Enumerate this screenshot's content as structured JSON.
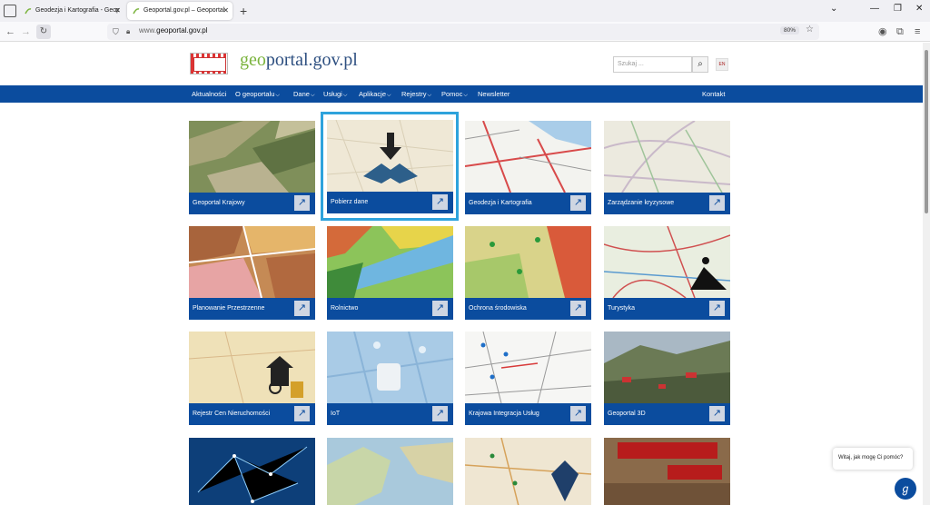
{
  "browser": {
    "tabs": [
      {
        "title": "Geodezja i Kartografia - Geopor"
      },
      {
        "title": "Geoportal.gov.pl – Geoportal In"
      }
    ],
    "url_prefix": "www.",
    "url_domain": "geoportal.gov.pl",
    "zoom": "80%"
  },
  "header": {
    "brand_geo": "geo",
    "brand_rest": "portal.gov.pl",
    "search_placeholder": "Szukaj ...",
    "lang": "EN"
  },
  "menu": {
    "items": [
      "Aktualności",
      "O geoportalu",
      "Dane",
      "Usługi",
      "Aplikacje",
      "Rejestry",
      "Pomoc",
      "Newsletter"
    ],
    "contact": "Kontakt"
  },
  "tiles": [
    "Geoportal Krajowy",
    "Pobierz dane",
    "Geodezja i Kartografia",
    "Zarządzanie kryzysowe",
    "Planowanie Przestrzenne",
    "Rolnictwo",
    "Ochrona środowiska",
    "Turystyka",
    "Rejestr Cen Nieruchomości",
    "IoT",
    "Krajowa Integracja Usług",
    "Geoportal 3D"
  ],
  "chat": {
    "bubble": "Witaj, jak mogę Ci pomóc?"
  },
  "colors": {
    "accent": "#0b4c9e",
    "highlight": "#2ea3dc"
  }
}
